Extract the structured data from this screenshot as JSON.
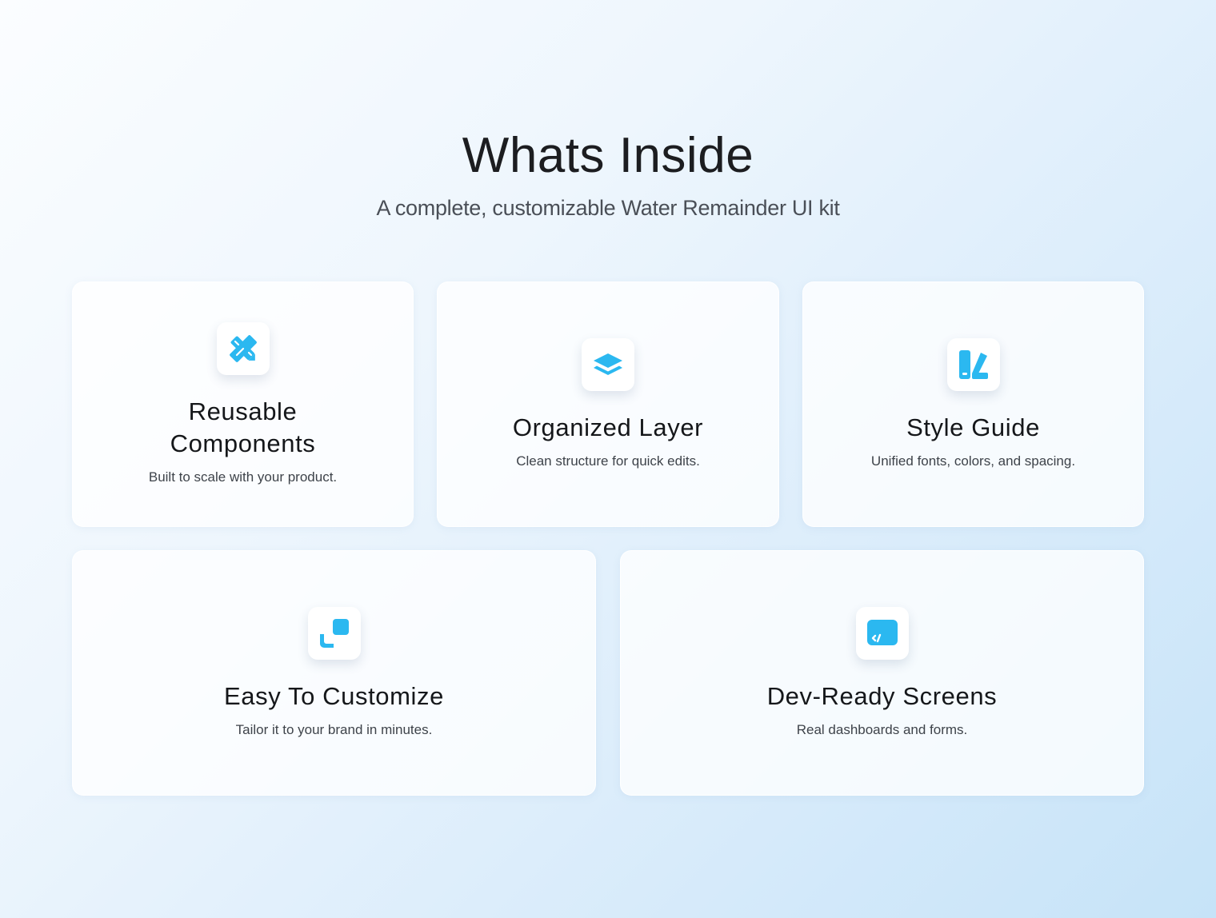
{
  "header": {
    "title": "Whats Inside",
    "subtitle": "A complete, customizable Water Remainder  UI kit"
  },
  "accent_color": "#2bb8f0",
  "cards": [
    {
      "icon": "pencil-ruler-icon",
      "title": "Reusable Components",
      "description": "Built to scale with your product."
    },
    {
      "icon": "layers-icon",
      "title": "Organized Layer",
      "description": "Clean structure for quick edits."
    },
    {
      "icon": "swatch-icon",
      "title": "Style Guide",
      "description": "Unified fonts, colors, and spacing."
    },
    {
      "icon": "resize-icon",
      "title": "Easy To Customize",
      "description": "Tailor it to your brand in minutes."
    },
    {
      "icon": "code-screen-icon",
      "title": "Dev-Ready Screens",
      "description": "Real dashboards and forms."
    }
  ]
}
